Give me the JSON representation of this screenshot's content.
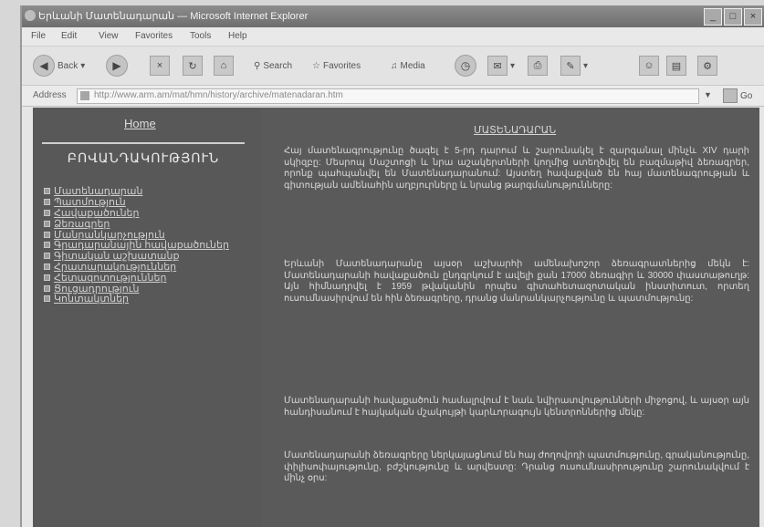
{
  "window": {
    "title": "Երևանի Մատենադարան — Microsoft Internet Explorer"
  },
  "menubar": {
    "items": [
      "File",
      "Edit",
      "View",
      "Favorites",
      "Tools",
      "Help"
    ]
  },
  "toolbar": {
    "back_label": "Back",
    "search_label": "Search",
    "favorites_label": "Favorites",
    "media_label": "Media"
  },
  "address": {
    "label": "Address",
    "url": "http://www.arm.am/mat/hmn/history/archive/matenadaran.htm",
    "go_label": "Go"
  },
  "page": {
    "home_link": "Home",
    "left_title": "ԲՈՎԱՆԴԱԿՈՒԹՅՈՒՆ",
    "nav_items": [
      "Մատենադարան",
      "Պատմություն",
      "Հավաքածուներ",
      "Ձեռագրեր",
      "Մանրանկարչություն",
      "Գրադարանային հավաքածուներ",
      "Գիտական աշխատանք",
      "Հրատարակություններ",
      "Հետազոտություններ",
      "Ցուցադրություն",
      "Կոնտակտներ"
    ],
    "heading": "ՄԱՏԵՆԱԴԱՐԱՆ",
    "paragraphs": [
      "Հայ մատենագրությունը ծագել է 5-րդ դարում և շարունակել է զարգանալ մինչև XIV դարի սկիզբը: Մեսրոպ Մաշտոցի և նրա աշակերտների կողմից ստեղծվել են բազմաթիվ ձեռագրեր, որոնք պահպանվել են Մատենադարանում: Այստեղ հավաքված են հայ մատենագրության և գիտության ամենահին աղբյուրները և նրանց թարգմանությունները:",
      "Երևանի Մատենադարանը այսօր աշխարհի ամենախոշոր ձեռագրատներից մեկն է: Մատենադարանի հավաքածուն ընդգրկում է ավելի քան 17000 ձեռագիր և 30000 փաստաթուղթ: Այն հիմնադրվել է 1959 թվականին որպես գիտահետազոտական ինստիտուտ, որտեղ ուսումնասիրվում են հին ձեռագրերը, դրանց մանրանկարչությունը և պատմությունը:",
      "Մատենադարանի հավաքածուն համալրվում է նաև նվիրատվությունների միջոցով, և այսօր այն հանդիսանում է հայկական մշակույթի կարևորագույն կենտրոններից մեկը:",
      "Մատենադարանի ձեռագրերը ներկայացնում են հայ ժողովրդի պատմությունը, գրականությունը, փիլիսոփայությունը, բժշկությունը և արվեստը: Դրանց ուսումնասիրությունը շարունակվում է մինչ օրս:"
    ]
  }
}
